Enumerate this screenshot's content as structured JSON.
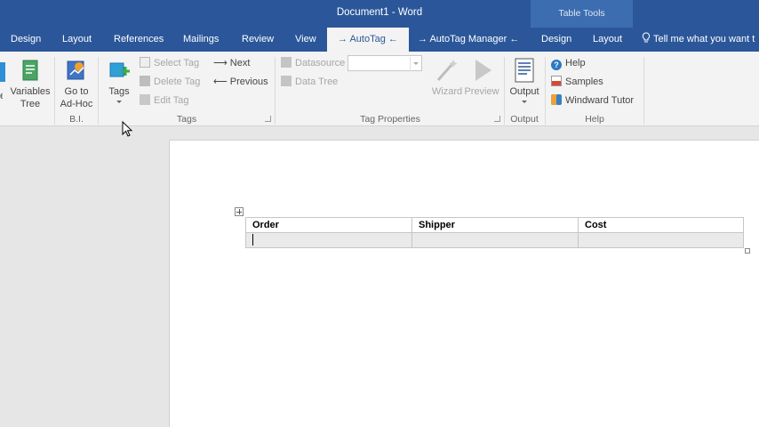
{
  "window": {
    "title": "Document1 - Word",
    "context_header": "Table Tools"
  },
  "tabs": [
    {
      "label": "Design"
    },
    {
      "label": "Layout"
    },
    {
      "label": "References"
    },
    {
      "label": "Mailings"
    },
    {
      "label": "Review"
    },
    {
      "label": "View"
    },
    {
      "label": "→ AutoTag ←"
    },
    {
      "label": "→ AutoTag Manager ←"
    },
    {
      "label": "Design"
    },
    {
      "label": "Layout"
    }
  ],
  "tell_me": "Tell me what you want t",
  "ribbon": {
    "variables_tree": "Variables\nTree",
    "variables_tree_l1": "Variables",
    "variables_tree_l2": "Tree",
    "goto_adhoc_l1": "Go to",
    "goto_adhoc_l2": "Ad-Hoc",
    "group_bi": "B.I.",
    "tags_btn": "Tags",
    "select_tag": "Select Tag",
    "delete_tag": "Delete Tag",
    "edit_tag": "Edit Tag",
    "next": "Next",
    "previous": "Previous",
    "group_tags": "Tags",
    "datasource": "Datasource",
    "data_tree": "Data Tree",
    "wizard": "Wizard",
    "preview": "Preview",
    "group_tag_properties": "Tag Properties",
    "output_btn": "Output",
    "group_output": "Output",
    "help": "Help",
    "samples": "Samples",
    "windward_tutor": "Windward Tutor",
    "group_help": "Help"
  },
  "document": {
    "table": {
      "headers": [
        "Order",
        "Shipper",
        "Cost"
      ],
      "rows": [
        [
          "",
          "",
          ""
        ]
      ]
    }
  },
  "colors": {
    "accent": "#2b579a",
    "context_tab": "#3c6db0"
  }
}
